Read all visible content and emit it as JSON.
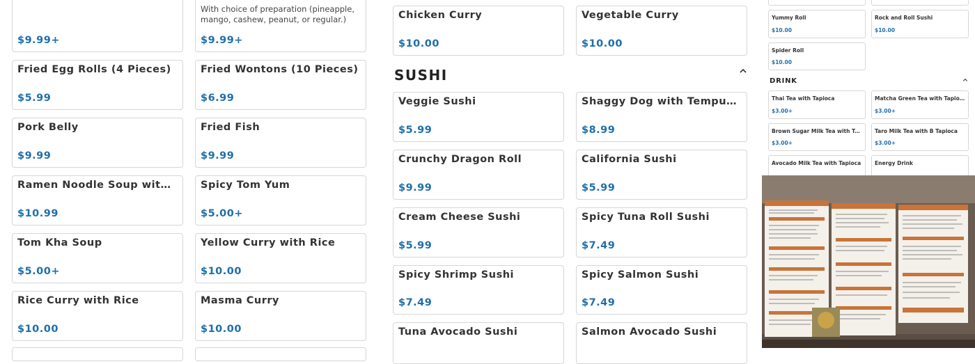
{
  "left_col_a": [
    {
      "name": "",
      "price": "$9.99+"
    },
    {
      "name": "Fried Egg Rolls (4 Pieces)",
      "price": "$5.99"
    },
    {
      "name": "Pork Belly",
      "price": "$9.99"
    },
    {
      "name": "Ramen Noodle Soup with Pork Belly",
      "price": "$10.99"
    },
    {
      "name": "Tom Kha Soup",
      "price": "$5.00+"
    },
    {
      "name": "Rice Curry with Rice",
      "price": "$10.00"
    }
  ],
  "left_col_b": [
    {
      "desc": "With choice of preparation (pineapple, mango, cashew, peanut, or regular.)",
      "price": "$9.99+"
    },
    {
      "name": "Fried Wontons (10 Pieces)",
      "price": "$6.99"
    },
    {
      "name": "Fried Fish",
      "price": "$9.99"
    },
    {
      "name": "Spicy Tom Yum",
      "price": "$5.00+"
    },
    {
      "name": "Yellow Curry with Rice",
      "price": "$10.00"
    },
    {
      "name": "Masma Curry",
      "price": "$10.00"
    }
  ],
  "middle": {
    "curry_row": [
      {
        "name": "Chicken Curry",
        "price": "$10.00"
      },
      {
        "name": "Vegetable Curry",
        "price": "$10.00"
      }
    ],
    "sushi_title": "SUSHI",
    "sushi": [
      {
        "name": "Veggie Sushi",
        "price": "$5.99"
      },
      {
        "name": "Shaggy Dog with Tempura Shrimp",
        "price": "$8.99"
      },
      {
        "name": "Crunchy Dragon Roll",
        "price": "$9.99"
      },
      {
        "name": "California Sushi",
        "price": "$5.99"
      },
      {
        "name": "Cream Cheese Sushi",
        "price": "$5.99"
      },
      {
        "name": "Spicy Tuna Roll Sushi",
        "price": "$7.49"
      },
      {
        "name": "Spicy Shrimp Sushi",
        "price": "$7.49"
      },
      {
        "name": "Spicy Salmon Sushi",
        "price": "$7.49"
      },
      {
        "name": "Tuna Avocado Sushi",
        "price": ""
      },
      {
        "name": "Salmon Avocado Sushi",
        "price": ""
      }
    ]
  },
  "right_panel": {
    "sushi_items": [
      {
        "name": "Yummy Roll",
        "price": "$10.00"
      },
      {
        "name": "Rock and Roll Sushi",
        "price": "$10.00"
      },
      {
        "name": "Spider Roll",
        "price": "$10.00"
      }
    ],
    "drink_title": "DRINK",
    "drinks": [
      {
        "name": "Thai Tea with Tapioca",
        "price": "$3.00+"
      },
      {
        "name": "Matcha Green Tea with Tapioca",
        "price": "$3.00+"
      },
      {
        "name": "Brown Sugar Milk Tea with Tapioca",
        "price": "$3.00+"
      },
      {
        "name": "Taro Milk Tea with B Tapioca",
        "price": "$3.00+"
      },
      {
        "name": "Avocado Milk Tea with Tapioca",
        "price": ""
      },
      {
        "name": "Energy Drink",
        "price": ""
      }
    ]
  },
  "colors": {
    "price": "#1f6fab",
    "border": "#d6d6d6",
    "text": "#333333"
  },
  "icons": {
    "collapse": "chevron-up-icon"
  }
}
